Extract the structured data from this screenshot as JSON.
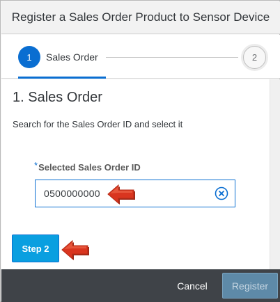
{
  "dialog": {
    "title": "Register a Sales Order Product to Sensor Device"
  },
  "wizard": {
    "steps": [
      {
        "number": "1",
        "label": "Sales Order",
        "state": "active"
      },
      {
        "number": "2",
        "label": "",
        "state": "inactive"
      }
    ]
  },
  "section": {
    "title": "1. Sales Order",
    "instructions": "Search for the Sales Order ID and select it"
  },
  "field": {
    "required_marker": "*",
    "label": "Selected Sales Order ID",
    "value": "0500000000",
    "clear_icon": "clear-circle-icon"
  },
  "buttons": {
    "next_step": "Step 2",
    "cancel": "Cancel",
    "register": "Register"
  },
  "annotations": {
    "arrow_icon": "red-arrow-pointer-icon",
    "arrow_color": "#d9351f"
  },
  "colors": {
    "accent": "#0a6ed1",
    "button": "#0a9fe0",
    "footer": "#3f4348"
  }
}
